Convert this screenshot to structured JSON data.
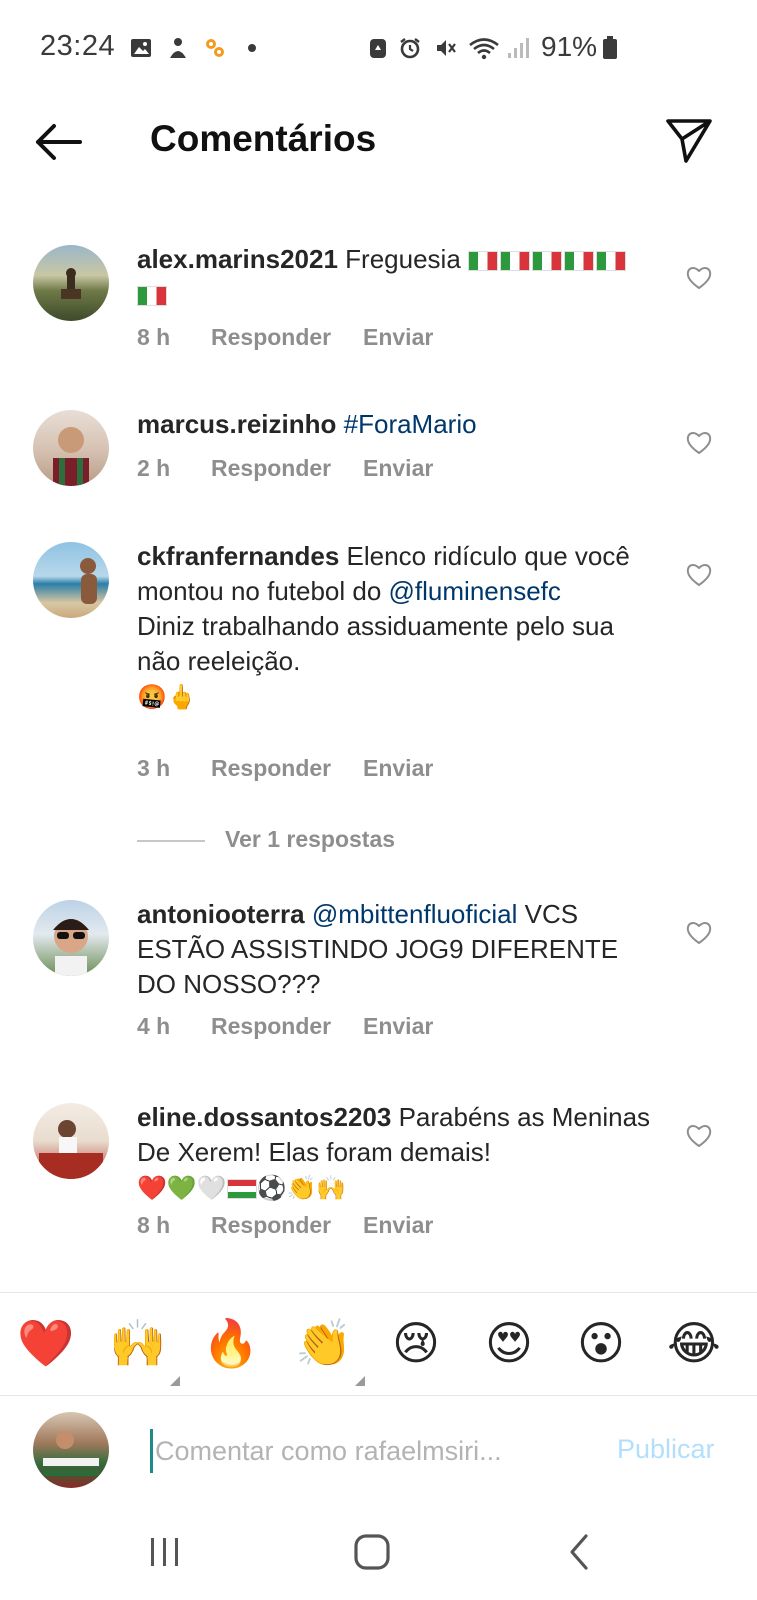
{
  "status_bar": {
    "time": "23:24",
    "battery": "91%",
    "icons": [
      "image-icon",
      "app-icon",
      "app-icon",
      "dot-icon",
      "battery-saver-icon",
      "alarm-icon",
      "mute-icon",
      "wifi-icon",
      "signal-icon",
      "battery-icon"
    ]
  },
  "header": {
    "title": "Comentários",
    "back_icon": "arrow-left-icon",
    "send_icon": "paper-plane-icon"
  },
  "comments": [
    {
      "username": "alex.marins2021",
      "text": " Freguesia ",
      "emojis_flags": 6,
      "time": "8 h",
      "reply": "Responder",
      "send": "Enviar"
    },
    {
      "username": "marcus.reizinho",
      "text": " ",
      "hashtag": "#ForaMario",
      "time": "2 h",
      "reply": "Responder",
      "send": "Enviar"
    },
    {
      "username": "ckfranfernandes",
      "text": " Elenco ridículo que você montou no futebol do ",
      "mention": "@fluminensefc",
      "text2": "Diniz trabalhando assiduamente pelo sua não reeleição.",
      "emojis": "🤬🖕",
      "time": "3 h",
      "reply": "Responder",
      "send": "Enviar",
      "view_replies": "Ver 1 respostas"
    },
    {
      "username": "antoniooterra",
      "text_pre": " ",
      "mention": "@mbittenfluoficial",
      "text": " VCS ESTÃO ASSISTINDO JOG9 DIFERENTE DO NOSSO???",
      "time": "4 h",
      "reply": "Responder",
      "send": "Enviar"
    },
    {
      "username": "eline.dossantos2203",
      "text": " Parabéns as Meninas De Xerem! Elas foram demais!",
      "emojis_a": "❤️💚🤍",
      "emojis_b": "⚽👏🙌",
      "time": "8 h",
      "reply": "Responder",
      "send": "Enviar"
    }
  ],
  "quick_emojis": [
    "❤️",
    "🙌",
    "🔥",
    "👏",
    "😢",
    "😍",
    "😮",
    "😂"
  ],
  "composer": {
    "placeholder": "Comentar como rafaelmsiri...",
    "publish": "Publicar"
  },
  "nav_bar": {
    "icons": [
      "recent-apps-icon",
      "home-icon",
      "back-icon"
    ]
  }
}
